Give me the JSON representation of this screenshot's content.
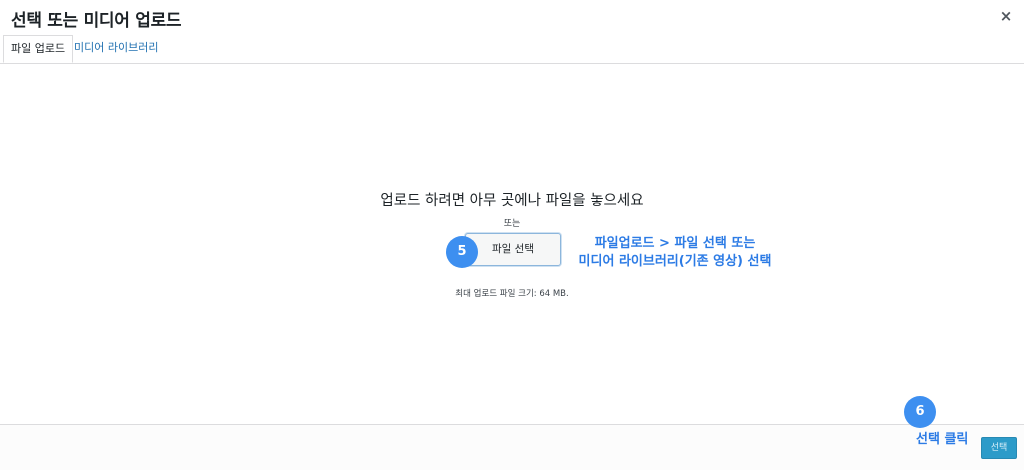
{
  "modal": {
    "title": "선택 또는 미디어 업로드",
    "close_icon": "×"
  },
  "tabs": [
    {
      "label": "파일 업로드",
      "active": true
    },
    {
      "label": "미디어 라이브러리",
      "active": false
    }
  ],
  "upload": {
    "heading": "업로드 하려면 아무 곳에나 파일을 놓으세요",
    "or": "또는",
    "file_button": "파일 선택",
    "max_size": "최대 업로드 파일 크기: 64 MB."
  },
  "annotations": {
    "badge_5": "5",
    "line_1": "파일업로드 > 파일 선택  또는",
    "line_2": "미디어 라이브러리(기존 영상) 선택",
    "badge_6": "6",
    "select_click": "선택 클릭"
  },
  "footer": {
    "select_button": "선택"
  },
  "colors": {
    "link": "#2271b1",
    "annotation": "#2c7be5",
    "badge": "#3d8ff0",
    "select_button": "#2c9bc9"
  }
}
